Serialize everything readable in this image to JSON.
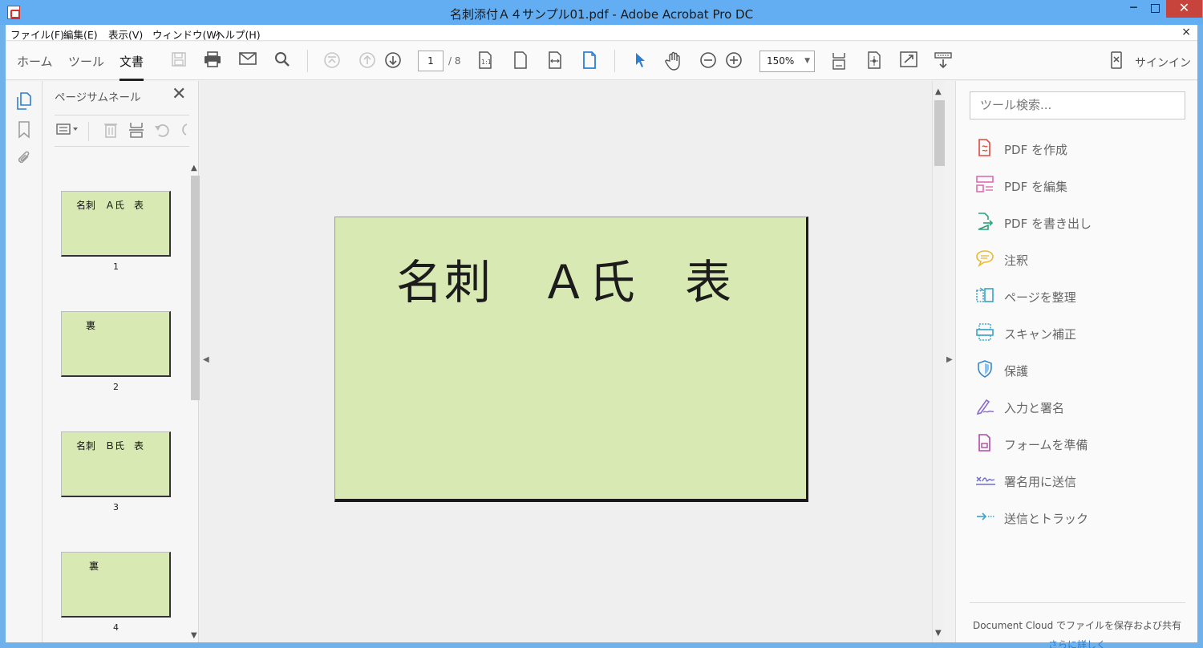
{
  "window": {
    "title": "名刺添付Ａ４サンプル01.pdf - Adobe Acrobat Pro DC",
    "minimize": "─",
    "maximize": "□",
    "close": "✕"
  },
  "menubar": {
    "items": [
      "ファイル(F)",
      "編集(E)",
      "表示(V)",
      "ウィンドウ(W)",
      "ヘルプ(H)"
    ],
    "close_doc": "×"
  },
  "toolbar": {
    "tabs": [
      "ホーム",
      "ツール",
      "文書"
    ],
    "active_tab": "文書",
    "current_page": "1",
    "total_pages": "/ 8",
    "zoom": "150%",
    "signin": "サインイン"
  },
  "thumbnails_panel": {
    "title": "ページサムネール",
    "close": "✕",
    "pages": [
      {
        "text": "名刺　Ａ氏　表",
        "number": "1"
      },
      {
        "text": "裏",
        "number": "2"
      },
      {
        "text": "名刺　Ｂ氏　表",
        "number": "3"
      },
      {
        "text": "裏",
        "number": "4"
      }
    ]
  },
  "document": {
    "card_text": "名刺　Ａ氏　表",
    "card_color": "#d9e9b3"
  },
  "tools_pane": {
    "search_placeholder": "ツール検索...",
    "tools": [
      {
        "label": "PDF を作成",
        "icon": "create-pdf-icon",
        "color": "#e0493f"
      },
      {
        "label": "PDF を編集",
        "icon": "edit-pdf-icon",
        "color": "#e06cb4"
      },
      {
        "label": "PDF を書き出し",
        "icon": "export-pdf-icon",
        "color": "#2aa37a"
      },
      {
        "label": "注釈",
        "icon": "comment-icon",
        "color": "#e9b92e"
      },
      {
        "label": "ページを整理",
        "icon": "organize-pages-icon",
        "color": "#3aa6c9"
      },
      {
        "label": "スキャン補正",
        "icon": "scan-icon",
        "color": "#3aa6c9"
      },
      {
        "label": "保護",
        "icon": "shield-icon",
        "color": "#3a86c9"
      },
      {
        "label": "入力と署名",
        "icon": "fill-sign-icon",
        "color": "#8a68d6"
      },
      {
        "label": "フォームを準備",
        "icon": "prepare-form-icon",
        "color": "#b24aa6"
      },
      {
        "label": "署名用に送信",
        "icon": "send-for-signature-icon",
        "color": "#6c6cd6"
      },
      {
        "label": "送信とトラック",
        "icon": "send-track-icon",
        "color": "#3aa6c9"
      }
    ],
    "document_cloud_text": "Document Cloud でファイルを保存および共有",
    "more_link": "さらに詳しく"
  }
}
